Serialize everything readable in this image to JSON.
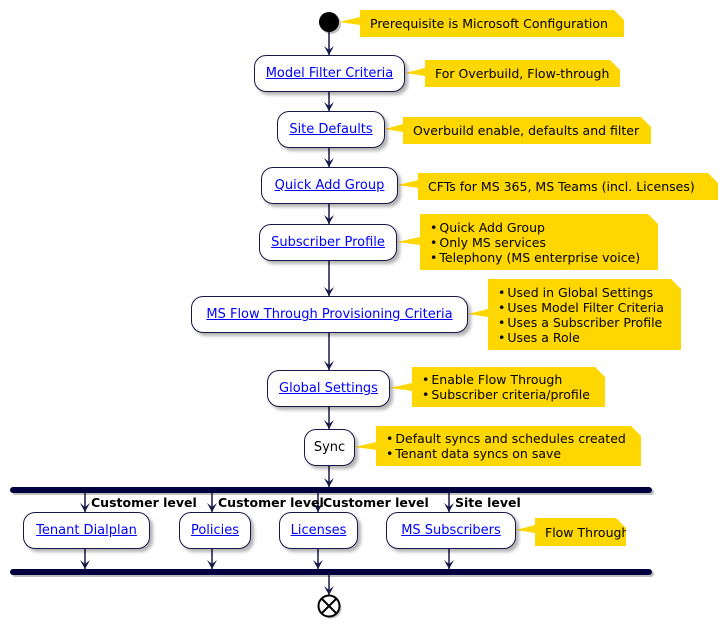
{
  "notes": {
    "start": "Prerequisite is Microsoft Configuration",
    "model_filter": "For Overbuild, Flow-through",
    "site_defaults": "Overbuild enable, defaults and filter",
    "quick_add": "CFTs for MS 365, MS Teams (incl. Licenses)",
    "subscriber_profile": [
      "Quick Add Group",
      "Only MS services",
      "Telephony (MS enterprise voice)"
    ],
    "ms_flow": [
      "Used in Global Settings",
      "Uses Model Filter Criteria",
      "Uses a Subscriber Profile",
      "Uses a Role"
    ],
    "global_settings": [
      "Enable Flow Through",
      "Subscriber criteria/profile"
    ],
    "sync": [
      "Default syncs and schedules created",
      "Tenant data syncs on save"
    ],
    "ms_subscribers": "Flow Through"
  },
  "activities": {
    "model_filter": "Model Filter Criteria",
    "site_defaults": "Site Defaults",
    "quick_add": "Quick Add Group",
    "subscriber_profile": "Subscriber Profile",
    "ms_flow": "MS Flow Through Provisioning Criteria",
    "global_settings": "Global Settings",
    "sync": "Sync"
  },
  "branches": [
    {
      "label": "Customer level",
      "activity": "Tenant Dialplan"
    },
    {
      "label": "Customer level",
      "activity": "Policies"
    },
    {
      "label": "Customer level",
      "activity": "Licenses"
    },
    {
      "label": "Site level",
      "activity": "MS Subscribers"
    }
  ],
  "colors": {
    "note": "#ffd700",
    "line": "#181848",
    "link": "#0000ff"
  }
}
